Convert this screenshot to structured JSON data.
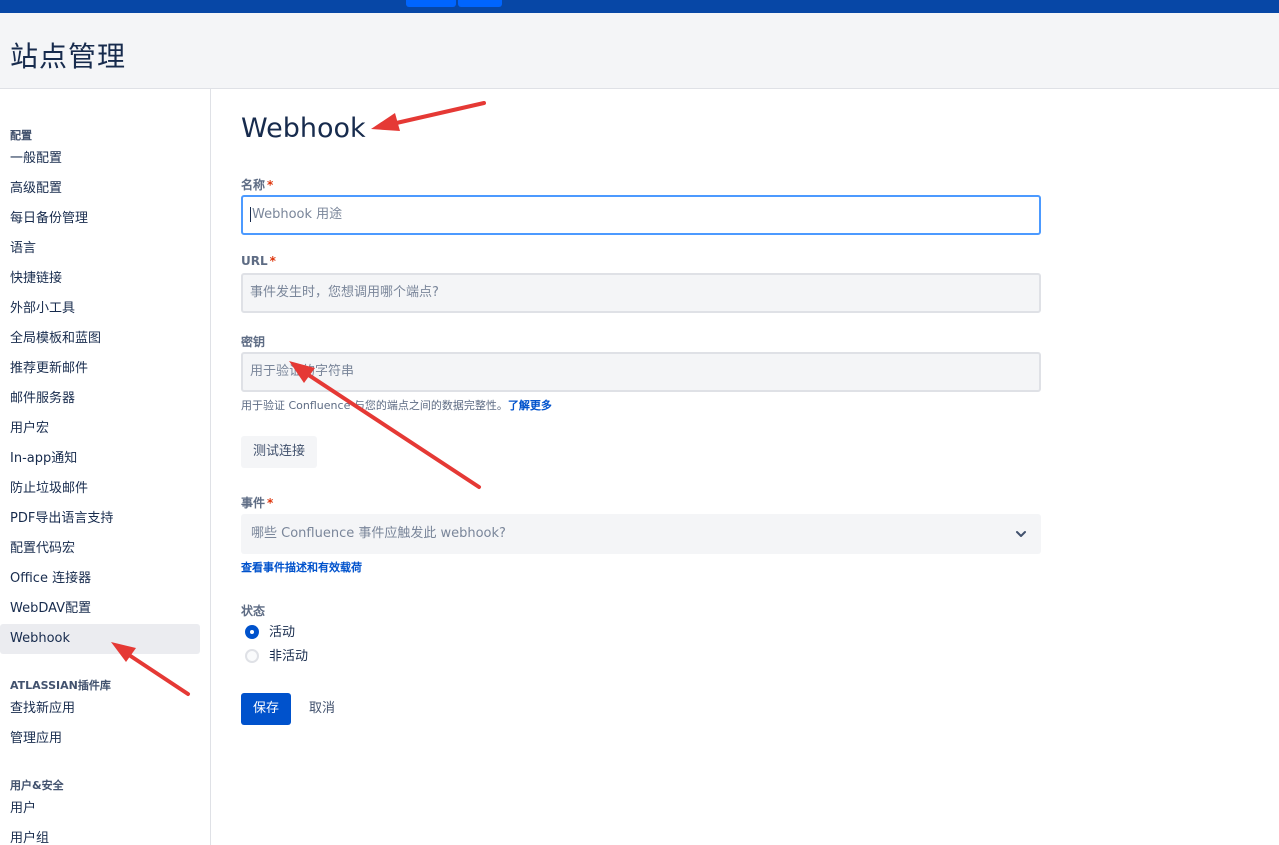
{
  "header": {
    "title": "站点管理"
  },
  "sidebar": {
    "sections": [
      {
        "title": "配置",
        "items": [
          "一般配置",
          "高级配置",
          "每日备份管理",
          "语言",
          "快捷链接",
          "外部小工具",
          "全局模板和蓝图",
          "推荐更新邮件",
          "邮件服务器",
          "用户宏",
          "In-app通知",
          "防止垃圾邮件",
          "PDF导出语言支持",
          "配置代码宏",
          "Office 连接器",
          "WebDAV配置",
          "Webhook"
        ]
      },
      {
        "title": "ATLASSIAN插件库",
        "items": [
          "查找新应用",
          "管理应用"
        ]
      },
      {
        "title": "用户&安全",
        "items": [
          "用户",
          "用户组"
        ]
      }
    ],
    "active_item": "Webhook"
  },
  "form": {
    "title": "Webhook",
    "name": {
      "label": "名称",
      "required": "*",
      "placeholder": "Webhook 用途"
    },
    "url": {
      "label": "URL",
      "required": "*",
      "placeholder": "事件发生时，您想调用哪个端点?"
    },
    "secret": {
      "label": "密钥",
      "placeholder": "用于验证的字符串",
      "help": "用于验证 Confluence 与您的端点之间的数据完整性。",
      "help_link": "了解更多"
    },
    "test_button": "测试连接",
    "events": {
      "label": "事件",
      "required": "*",
      "placeholder": "哪些 Confluence 事件应触发此 webhook?",
      "link": "查看事件描述和有效载荷"
    },
    "status": {
      "label": "状态",
      "options": [
        "活动",
        "非活动"
      ],
      "selected": "活动"
    },
    "save_button": "保存",
    "cancel_button": "取消"
  },
  "colors": {
    "brand": "#0747a6",
    "primary": "#0052cc",
    "annotation_arrow": "#e53935"
  }
}
